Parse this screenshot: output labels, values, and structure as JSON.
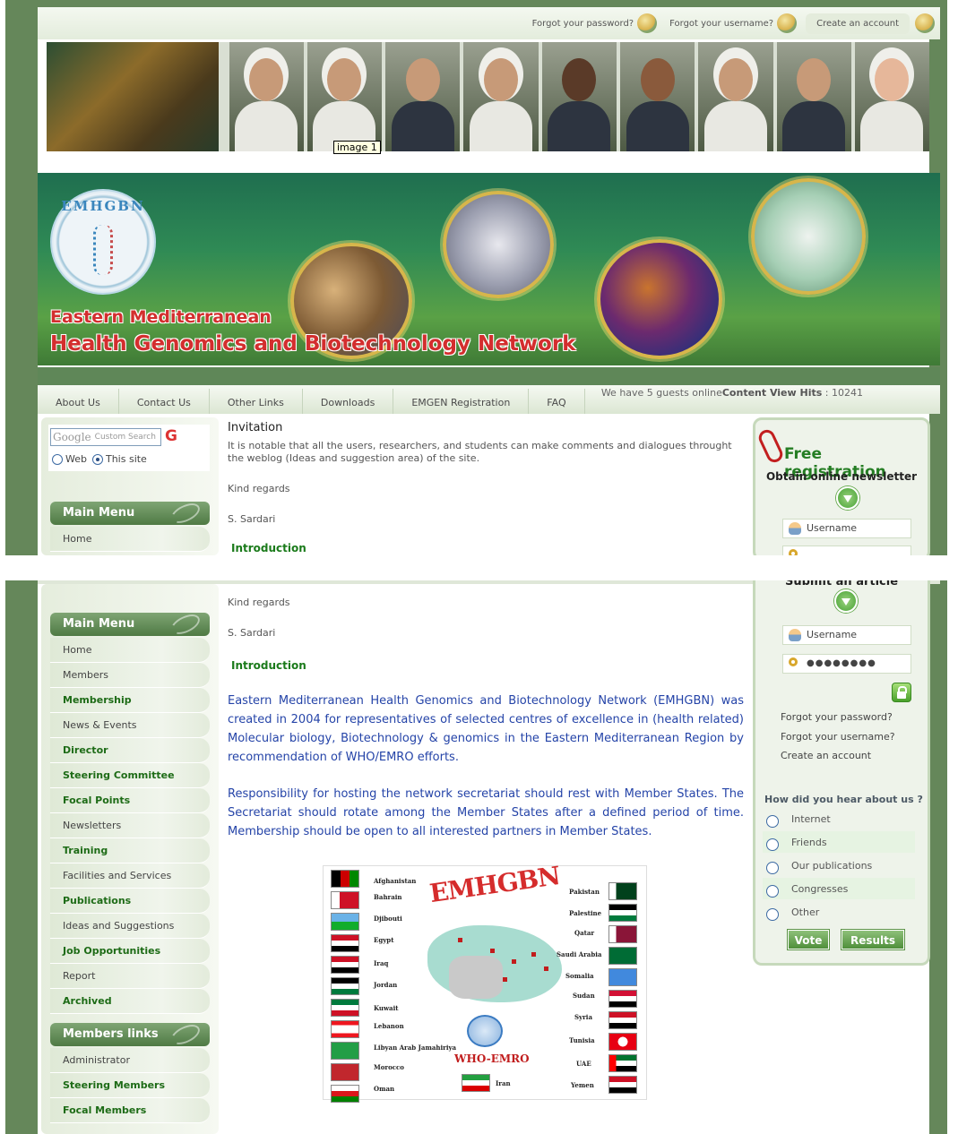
{
  "top_links": {
    "forgot_password": "Forgot your password?",
    "forgot_username": "Forgot your username?",
    "create_account": "Create an account"
  },
  "photo_tooltip": "image 1",
  "banner": {
    "logo_text": "EMHGBN",
    "title_line1": "Eastern Mediterranean",
    "title_line2": "Health Genomics and Biotechnology Network"
  },
  "nav": {
    "items": [
      "About Us",
      "Contact Us",
      "Other Links",
      "Downloads",
      "EMGEN Registration",
      "FAQ"
    ],
    "guests_text": "We have 5 guests online",
    "hits_label": "Content View Hits",
    "hits_value": " : 10241"
  },
  "search": {
    "placeholder": "Custom Search",
    "google": "Google",
    "go": "G",
    "opt_web": "Web",
    "opt_site": "This site"
  },
  "main_menu": {
    "title": "Main Menu",
    "items": [
      {
        "label": "Home",
        "bold": false
      },
      {
        "label": "Members",
        "bold": false
      },
      {
        "label": "Membership",
        "bold": true
      },
      {
        "label": "News & Events",
        "bold": false
      },
      {
        "label": "Director",
        "bold": true
      },
      {
        "label": "Steering Committee",
        "bold": true
      },
      {
        "label": "Focal Points",
        "bold": true
      },
      {
        "label": "Newsletters",
        "bold": false
      },
      {
        "label": "Training",
        "bold": true
      },
      {
        "label": "Facilities and Services",
        "bold": false
      },
      {
        "label": "Publications",
        "bold": true
      },
      {
        "label": "Ideas and Suggestions",
        "bold": false
      },
      {
        "label": "Job Opportunities",
        "bold": true
      },
      {
        "label": "Report",
        "bold": false
      },
      {
        "label": "Archived",
        "bold": true
      }
    ]
  },
  "members_links": {
    "title": "Members links",
    "items": [
      {
        "label": "Administrator",
        "bold": false
      },
      {
        "label": "Steering Members",
        "bold": true
      },
      {
        "label": "Focal Members",
        "bold": true
      }
    ]
  },
  "content": {
    "invitation_title": "Invitation",
    "invitation_text": "It is notable that all the users, researchers, and students can make comments and dialogues throught the weblog (Ideas and suggestion area) of the site.",
    "regards": "Kind regards",
    "signature": "S. Sardari",
    "intro_title": "Introduction",
    "intro_p1": "Eastern Mediterranean Health Genomics and Biotechnology Network (EMHGBN) was created in 2004 for representatives of selected centres of excellence in (health related) Molecular biology, Biotechnology & genomics in the Eastern Mediterranean Region by recommendation of WHO/EMRO efforts.",
    "intro_p2": "Responsibility for hosting the network secretariat should rest with Member States. The Secretariat should rotate among the Member States after a defined period of time. Membership should be open to all interested partners in Member States."
  },
  "map_image": {
    "title": "EMHGBN",
    "who": "WHO-EMRO",
    "left_countries": [
      "Afghanistan",
      "Bahrain",
      "Djibouti",
      "Egypt",
      "Iraq",
      "Jordan",
      "Kuwait",
      "Lebanon",
      "Libyan Arab Jamahiriya",
      "Morocco",
      "Oman"
    ],
    "right_countries": [
      "Pakistan",
      "Palestine",
      "Qatar",
      "Saudi Arabia",
      "Somalia",
      "Sudan",
      "Syria",
      "Tunisia",
      "UAE",
      "Yemen"
    ],
    "bottom_country": "Iran"
  },
  "sidebar_right": {
    "free_registration": "Free registration",
    "newsletter": "Obtain online newsletter",
    "submit_article": "Submit an article",
    "username_placeholder": "Username",
    "password_mask": "●●●●●●●●",
    "forgot_password": "Forgot your password?",
    "forgot_username": "Forgot your username?",
    "create_account": "Create an account"
  },
  "poll": {
    "question": "How did you hear about us ?",
    "options": [
      "Internet",
      "Friends",
      "Our publications",
      "Congresses",
      "Other"
    ],
    "vote": "Vote",
    "results": "Results"
  },
  "colors": {
    "frame_green": "#65875a",
    "menu_bold_green": "#1d6b16",
    "intro_text_blue": "#2544a8",
    "banner_title_red": "#d32e2e"
  }
}
